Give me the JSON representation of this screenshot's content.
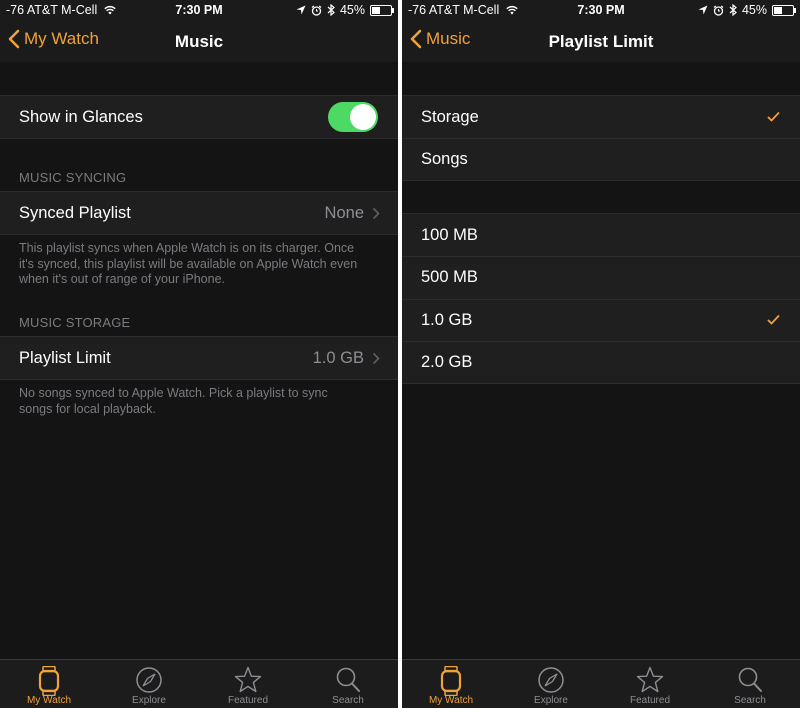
{
  "colors": {
    "accent": "#f0a23a",
    "toggle_on": "#4cd964",
    "background": "#1b1b1c",
    "cell": "#1f1f20"
  },
  "status_bar": {
    "carrier": "-76 AT&T M-Cell",
    "time": "7:30 PM",
    "battery": "45%"
  },
  "left_screen": {
    "nav": {
      "back_label": "My Watch",
      "title": "Music"
    },
    "glances": {
      "label": "Show in Glances",
      "enabled": true
    },
    "music_syncing": {
      "header": "MUSIC SYNCING",
      "synced_playlist_label": "Synced Playlist",
      "synced_playlist_value": "None",
      "footer_line1": "This playlist syncs when Apple Watch is on its charger. Once",
      "footer_line2": "it's synced, this playlist will be available on Apple Watch even",
      "footer_line3": "when it's out of range of your iPhone."
    },
    "music_storage": {
      "header": "MUSIC STORAGE",
      "playlist_limit_label": "Playlist Limit",
      "playlist_limit_value": "1.0 GB",
      "footer_line1": "No songs synced to Apple Watch. Pick a playlist to sync",
      "footer_line2": "songs for local playback."
    }
  },
  "right_screen": {
    "nav": {
      "back_label": "Music",
      "title": "Playlist Limit"
    },
    "limit_type_options": [
      {
        "label": "Storage",
        "selected": true
      },
      {
        "label": "Songs",
        "selected": false
      }
    ],
    "size_options": [
      {
        "label": "100 MB",
        "selected": false
      },
      {
        "label": "500 MB",
        "selected": false
      },
      {
        "label": "1.0 GB",
        "selected": true
      },
      {
        "label": "2.0 GB",
        "selected": false
      }
    ]
  },
  "tab_bar": {
    "tabs": [
      {
        "label": "My Watch",
        "icon": "watch-icon",
        "active": true
      },
      {
        "label": "Explore",
        "icon": "compass-icon",
        "active": false
      },
      {
        "label": "Featured",
        "icon": "star-icon",
        "active": false
      },
      {
        "label": "Search",
        "icon": "magnifier-icon",
        "active": false
      }
    ]
  }
}
